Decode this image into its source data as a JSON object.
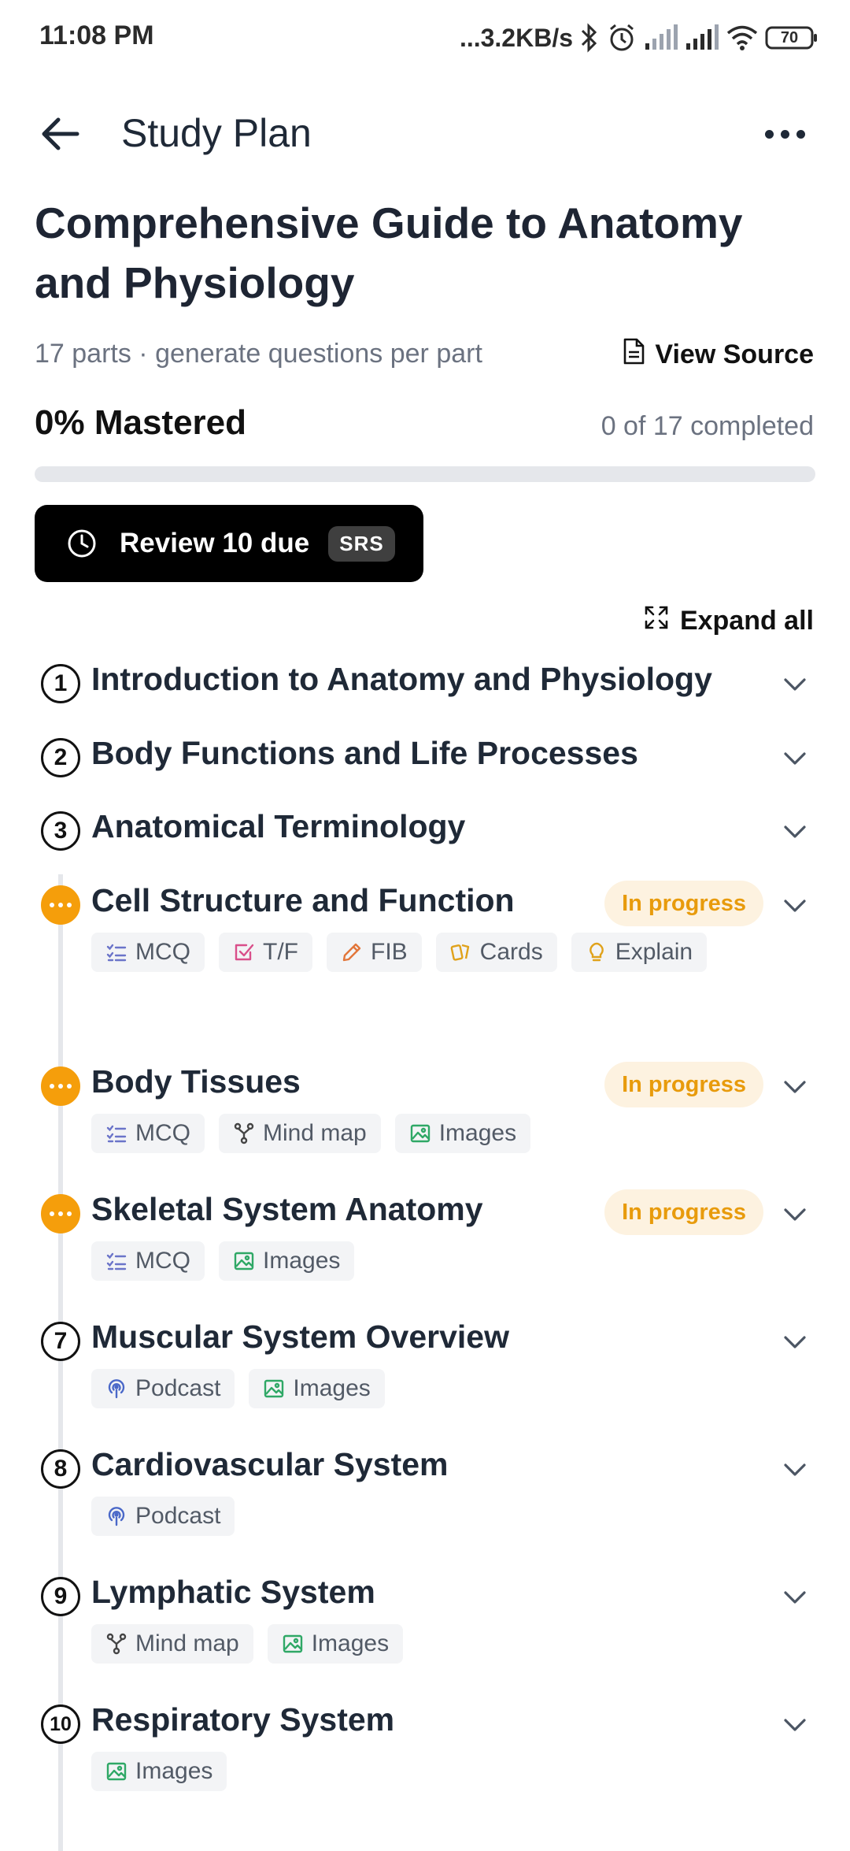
{
  "status_bar": {
    "time": "11:08 PM",
    "speed": "...3.2KB/s",
    "battery": "70",
    "icons": [
      "bluetooth-icon",
      "alarm-icon",
      "signal-icon",
      "signal-icon",
      "wifi-icon",
      "battery-icon"
    ]
  },
  "app_bar": {
    "title": "Study Plan",
    "back_icon": "arrow-left-icon",
    "more_icon": "more-horizontal-icon"
  },
  "plan": {
    "title": "Comprehensive Guide to Anatomy and Physiology",
    "subtitle": "17 parts · generate questions per part",
    "view_source_label": "View Source",
    "mastered_label": "0% Mastered",
    "completed_label": "0 of 17 completed",
    "progress_fraction": 0
  },
  "review": {
    "label": "Review 10 due",
    "badge": "SRS"
  },
  "expand_all_label": "Expand all",
  "parts": [
    {
      "number": "1",
      "title": "Introduction to Anatomy and Physiology",
      "status": "",
      "chips": []
    },
    {
      "number": "2",
      "title": "Body Functions and Life Processes",
      "status": "",
      "chips": []
    },
    {
      "number": "3",
      "title": "Anatomical Terminology",
      "status": "",
      "chips": []
    },
    {
      "number": "",
      "title": "Cell Structure and Function",
      "status": "In progress",
      "chips": [
        {
          "label": "MCQ",
          "icon": "checklist-icon"
        },
        {
          "label": "T/F",
          "icon": "checkbox-icon"
        },
        {
          "label": "FIB",
          "icon": "pencil-icon"
        },
        {
          "label": "Cards",
          "icon": "cards-icon"
        },
        {
          "label": "Explain",
          "icon": "lightbulb-icon"
        }
      ]
    },
    {
      "number": "",
      "title": "Body Tissues",
      "status": "In progress",
      "chips": [
        {
          "label": "MCQ",
          "icon": "checklist-icon"
        },
        {
          "label": "Mind map",
          "icon": "mindmap-icon"
        },
        {
          "label": "Images",
          "icon": "image-icon"
        }
      ]
    },
    {
      "number": "",
      "title": "Skeletal System Anatomy",
      "status": "In progress",
      "chips": [
        {
          "label": "MCQ",
          "icon": "checklist-icon"
        },
        {
          "label": "Images",
          "icon": "image-icon"
        }
      ]
    },
    {
      "number": "7",
      "title": "Muscular System Overview",
      "status": "",
      "chips": [
        {
          "label": "Podcast",
          "icon": "podcast-icon"
        },
        {
          "label": "Images",
          "icon": "image-icon"
        }
      ]
    },
    {
      "number": "8",
      "title": "Cardiovascular System",
      "status": "",
      "chips": [
        {
          "label": "Podcast",
          "icon": "podcast-icon"
        }
      ]
    },
    {
      "number": "9",
      "title": "Lymphatic System",
      "status": "",
      "chips": [
        {
          "label": "Mind map",
          "icon": "mindmap-icon"
        },
        {
          "label": "Images",
          "icon": "image-icon"
        }
      ]
    },
    {
      "number": "10",
      "title": "Respiratory System",
      "status": "",
      "chips": [
        {
          "label": "Images",
          "icon": "image-icon"
        }
      ]
    }
  ],
  "colors": {
    "accent_orange": "#f59e0b",
    "badge_bg": "#fdf2e0",
    "mcq": "#6b74c9",
    "tf": "#d94f8a",
    "fib": "#e2763a",
    "cards": "#e0a21b",
    "images": "#2fa866",
    "podcast": "#4a68c8"
  }
}
